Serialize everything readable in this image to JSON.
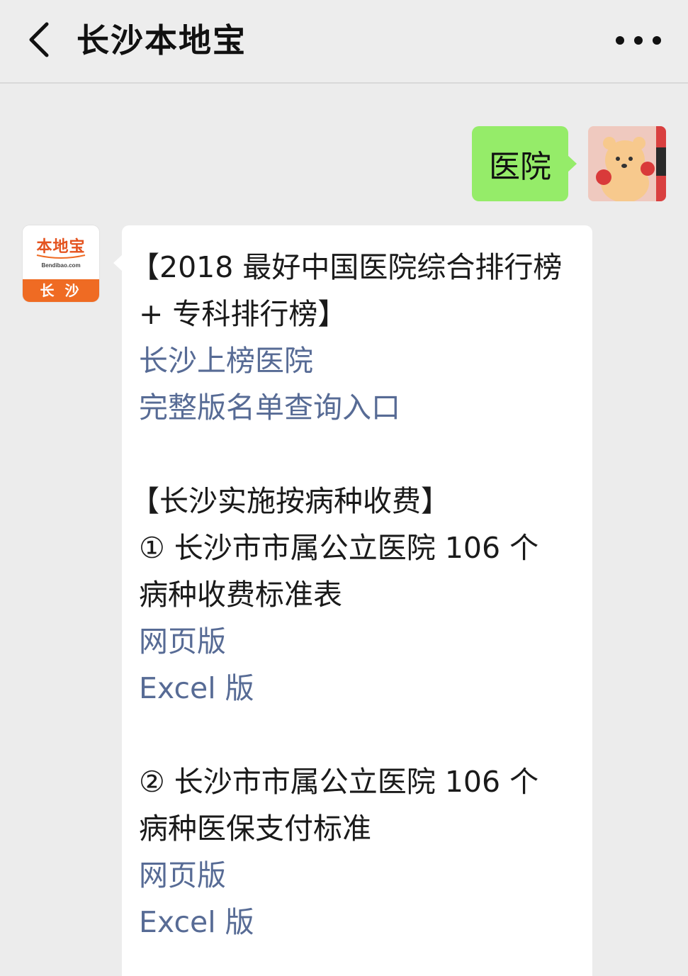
{
  "header": {
    "title": "长沙本地宝",
    "back_icon": "chevron-left-icon",
    "more_icon": "more-dots-icon"
  },
  "outgoing": {
    "text": "医院",
    "bubble_color": "#95ec69"
  },
  "bot": {
    "logo_main": "本地宝",
    "logo_sub": "Bendibao.com",
    "logo_city": "长 沙",
    "brand_color": "#ef6b23"
  },
  "message": {
    "section1_line1": "【2018 最好中国医院综合排行榜",
    "section1_line2": "+ 专科排行榜】",
    "section1_link1": "长沙上榜医院",
    "section1_link2": "完整版名单查询入口",
    "section2_title": "【长沙实施按病种收费】",
    "item1_line1": "① 长沙市市属公立医院 106 个",
    "item1_line2": "病种收费标准表",
    "item1_link_web": "网页版",
    "item1_link_excel": "Excel 版",
    "item2_line1": "② 长沙市市属公立医院 106 个",
    "item2_line2": "病种医保支付标准",
    "item2_link_web": "网页版",
    "item2_link_excel": "Excel 版",
    "link_color": "#576b95"
  }
}
